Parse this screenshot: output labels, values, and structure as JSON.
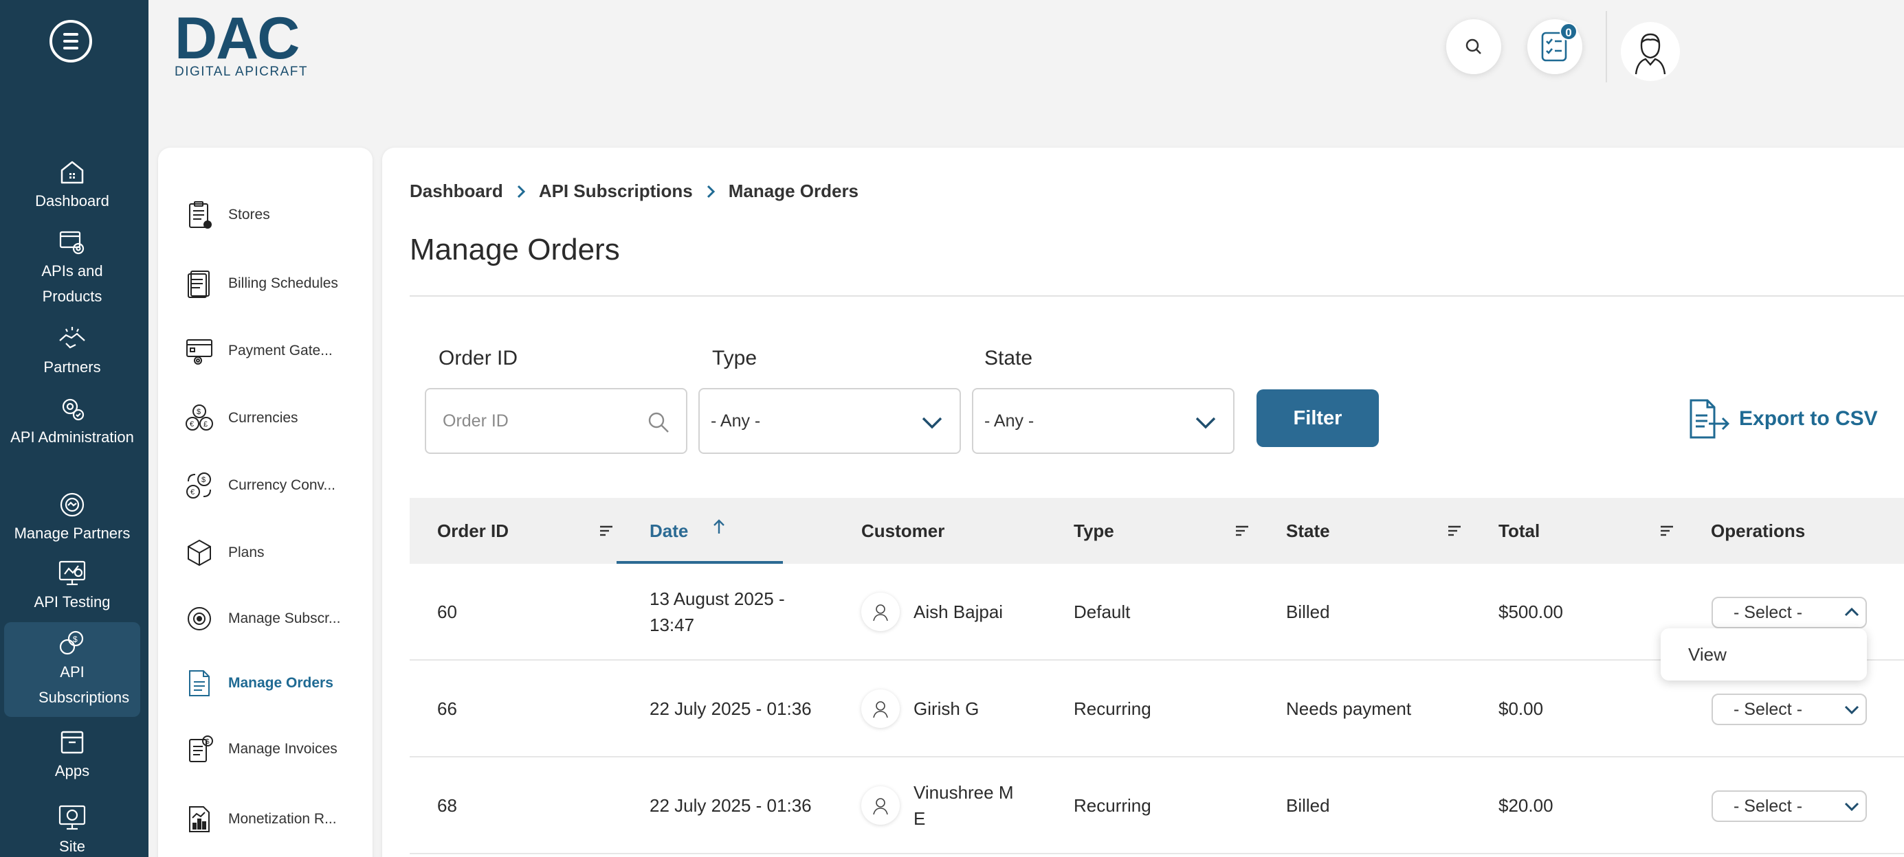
{
  "rail": {
    "items": [
      {
        "label": "Dashboard",
        "icon": "home-icon"
      },
      {
        "label": "APIs and Products",
        "icon": "api-products-icon"
      },
      {
        "label": "Partners",
        "icon": "partners-icon"
      },
      {
        "label": "API Administration",
        "icon": "api-admin-icon"
      },
      {
        "label": "Manage Partners",
        "icon": "manage-partners-icon"
      },
      {
        "label": "API Testing",
        "icon": "api-testing-icon"
      },
      {
        "label": "API Subscriptions",
        "icon": "api-subscriptions-icon"
      },
      {
        "label": "Apps",
        "icon": "apps-icon"
      },
      {
        "label": "Site",
        "icon": "site-icon"
      }
    ]
  },
  "header": {
    "logo_big": "DAC",
    "logo_small": "DIGITAL APICRAFT",
    "tasks_badge": "0"
  },
  "subnav": {
    "items": [
      {
        "label": "Stores"
      },
      {
        "label": "Billing Schedules"
      },
      {
        "label": "Payment Gate..."
      },
      {
        "label": "Currencies"
      },
      {
        "label": "Currency Conv..."
      },
      {
        "label": "Plans"
      },
      {
        "label": "Manage Subscr..."
      },
      {
        "label": "Manage Orders"
      },
      {
        "label": "Manage Invoices"
      },
      {
        "label": "Monetization R..."
      }
    ]
  },
  "breadcrumb": {
    "items": [
      "Dashboard",
      "API Subscriptions",
      "Manage Orders"
    ]
  },
  "page": {
    "title": "Manage Orders"
  },
  "filters": {
    "order_id_label": "Order ID",
    "order_id_placeholder": "Order ID",
    "type_label": "Type",
    "type_value": "- Any -",
    "state_label": "State",
    "state_value": "- Any -",
    "filter_button": "Filter",
    "export_label": "Export to CSV"
  },
  "table": {
    "columns": [
      "Order ID",
      "Date",
      "Customer",
      "Type",
      "State",
      "Total",
      "Operations"
    ],
    "rows": [
      {
        "order_id": "60",
        "date_1": "13 August 2025 -",
        "date_2": "13:47",
        "customer_1": "Aish Bajpai",
        "customer_2": "",
        "type": "Default",
        "state": "Billed",
        "total": "$500.00",
        "operation": "- Select -"
      },
      {
        "order_id": "66",
        "date_1": "22 July 2025 - 01:36",
        "date_2": "",
        "customer_1": "Girish G",
        "customer_2": "",
        "type": "Recurring",
        "state": "Needs payment",
        "total": "$0.00",
        "operation": "- Select -"
      },
      {
        "order_id": "68",
        "date_1": "22 July 2025 - 01:36",
        "date_2": "",
        "customer_1": "Vinushree M",
        "customer_2": "E",
        "type": "Recurring",
        "state": "Billed",
        "total": "$20.00",
        "operation": "- Select -"
      }
    ],
    "dropdown_option": "View"
  },
  "colors": {
    "rail_bg": "#1b3d52",
    "accent": "#2b6a93",
    "page_bg": "#f3f3f3"
  }
}
